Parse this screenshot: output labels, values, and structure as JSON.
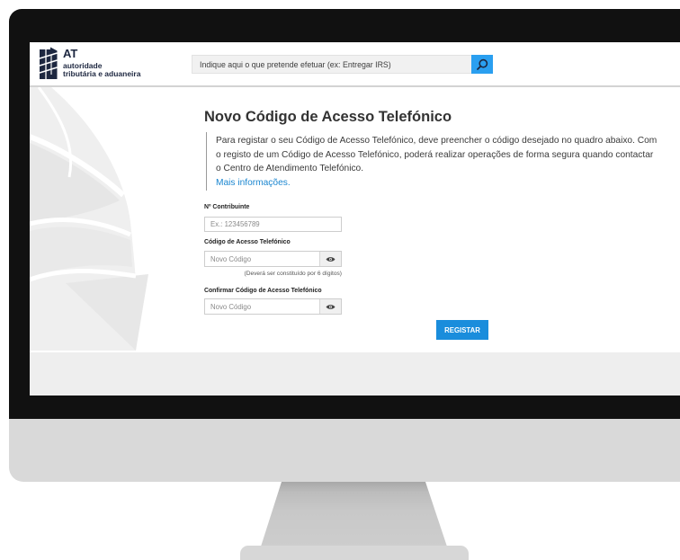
{
  "header": {
    "logo": {
      "abbr": "AT",
      "line1": "autoridade",
      "line2": "tributária e aduaneira",
      "icon": "at-emblem-icon"
    },
    "search": {
      "placeholder": "Indique aqui o que pretende efetuar (ex: Entregar IRS)",
      "icon": "search-icon"
    }
  },
  "main": {
    "title": "Novo Código de Acesso Telefónico",
    "intro_lines": [
      "Para registar o seu Código de Acesso Telefónico, deve preencher o código desejado no quadro abaixo. Com",
      "o registo de um Código de Acesso Telefónico, poderá realizar operações de forma segura quando contactar",
      "o Centro de Atendimento Telefónico."
    ],
    "more_info_link": "Mais informações.",
    "form": {
      "nif": {
        "label": "Nº Contribuinte",
        "placeholder": "Ex.: 123456789"
      },
      "code": {
        "label": "Código de Acesso Telefónico",
        "placeholder": "Novo Código",
        "hint": "(Deverá ser constituído por 6 dígitos)",
        "toggle_icon": "eye-icon"
      },
      "confirm": {
        "label": "Confirmar Código de Acesso Telefónico",
        "placeholder": "Novo Código",
        "toggle_icon": "eye-icon"
      },
      "submit_label": "REGISTAR"
    }
  },
  "colors": {
    "accent": "#1a8ddc",
    "search-button": "#2a9ff0",
    "link": "#1a86d0",
    "brand-dark": "#1d2740",
    "footer-bg": "#eeeeee",
    "bezel": "#111111"
  }
}
